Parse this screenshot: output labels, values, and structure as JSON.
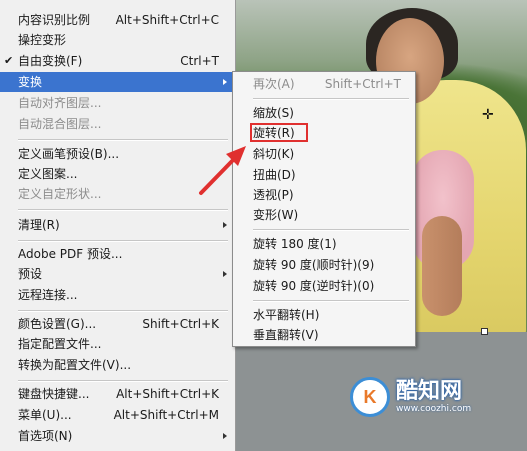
{
  "menu": {
    "items": [
      {
        "label": "内容识别比例",
        "shortcut": "Alt+Shift+Ctrl+C",
        "state": "normal"
      },
      {
        "label": "操控变形",
        "shortcut": "",
        "state": "normal"
      },
      {
        "label": "自由变换(F)",
        "shortcut": "Ctrl+T",
        "state": "checked",
        "check": "✔"
      },
      {
        "label": "变换",
        "shortcut": "",
        "state": "highlighted",
        "submenu": true
      },
      {
        "label": "自动对齐图层...",
        "shortcut": "",
        "state": "disabled"
      },
      {
        "label": "自动混合图层...",
        "shortcut": "",
        "state": "disabled"
      },
      {
        "label": "定义画笔预设(B)...",
        "shortcut": "",
        "state": "normal"
      },
      {
        "label": "定义图案...",
        "shortcut": "",
        "state": "normal"
      },
      {
        "label": "定义自定形状...",
        "shortcut": "",
        "state": "disabled"
      },
      {
        "label": "清理(R)",
        "shortcut": "",
        "state": "normal",
        "submenu": true
      },
      {
        "label": "Adobe PDF 预设...",
        "shortcut": "",
        "state": "normal"
      },
      {
        "label": "预设",
        "shortcut": "",
        "state": "normal",
        "submenu": true
      },
      {
        "label": "远程连接...",
        "shortcut": "",
        "state": "normal"
      },
      {
        "label": "颜色设置(G)...",
        "shortcut": "Shift+Ctrl+K",
        "state": "normal"
      },
      {
        "label": "指定配置文件...",
        "shortcut": "",
        "state": "normal"
      },
      {
        "label": "转换为配置文件(V)...",
        "shortcut": "",
        "state": "normal"
      },
      {
        "label": "键盘快捷键...",
        "shortcut": "Alt+Shift+Ctrl+K",
        "state": "normal"
      },
      {
        "label": "菜单(U)...",
        "shortcut": "Alt+Shift+Ctrl+M",
        "state": "normal"
      },
      {
        "label": "首选项(N)",
        "shortcut": "",
        "state": "normal",
        "submenu": true
      }
    ]
  },
  "submenu": {
    "items": [
      {
        "label": "再次(A)",
        "shortcut": "Shift+Ctrl+T",
        "state": "disabled"
      },
      {
        "label": "缩放(S)",
        "shortcut": "",
        "state": "normal"
      },
      {
        "label": "旋转(R)",
        "shortcut": "",
        "state": "normal",
        "boxed": true
      },
      {
        "label": "斜切(K)",
        "shortcut": "",
        "state": "normal"
      },
      {
        "label": "扭曲(D)",
        "shortcut": "",
        "state": "normal"
      },
      {
        "label": "透视(P)",
        "shortcut": "",
        "state": "normal"
      },
      {
        "label": "变形(W)",
        "shortcut": "",
        "state": "normal"
      },
      {
        "label": "旋转 180 度(1)",
        "shortcut": "",
        "state": "normal"
      },
      {
        "label": "旋转 90 度(顺时针)(9)",
        "shortcut": "",
        "state": "normal"
      },
      {
        "label": "旋转 90 度(逆时针)(0)",
        "shortcut": "",
        "state": "normal"
      },
      {
        "label": "水平翻转(H)",
        "shortcut": "",
        "state": "normal"
      },
      {
        "label": "垂直翻转(V)",
        "shortcut": "",
        "state": "normal"
      }
    ]
  },
  "watermark": {
    "logo_letter": "K",
    "name": "酷知网",
    "url": "www.coozhi.com"
  },
  "colors": {
    "highlight": "#3b74cf",
    "annotation": "#e0302f",
    "disabled_text": "#8c8c8c"
  }
}
